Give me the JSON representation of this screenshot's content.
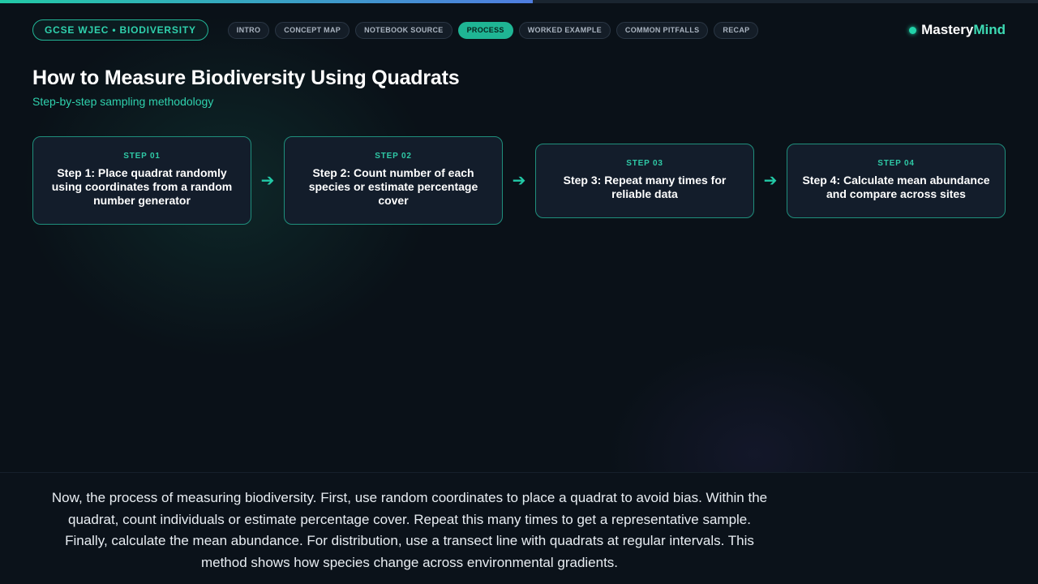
{
  "progress": {
    "fraction": 0.513
  },
  "header": {
    "course_badge": "GCSE WJEC • BIODIVERSITY",
    "tabs": [
      {
        "label": "INTRO",
        "active": false
      },
      {
        "label": "CONCEPT MAP",
        "active": false
      },
      {
        "label": "NOTEBOOK SOURCE",
        "active": false
      },
      {
        "label": "PROCESS",
        "active": true
      },
      {
        "label": "WORKED EXAMPLE",
        "active": false
      },
      {
        "label": "COMMON PITFALLS",
        "active": false
      },
      {
        "label": "RECAP",
        "active": false
      }
    ],
    "brand": {
      "part1": "Mastery",
      "part2": "Mind"
    }
  },
  "main": {
    "title": "How to Measure Biodiversity Using Quadrats",
    "subtitle": "Step-by-step sampling methodology",
    "steps": [
      {
        "number": "STEP 01",
        "text": "Step 1: Place quadrat randomly using coordinates from a random number generator"
      },
      {
        "number": "STEP 02",
        "text": "Step 2: Count number of each species or estimate percentage cover"
      },
      {
        "number": "STEP 03",
        "text": "Step 3: Repeat many times for reliable data"
      },
      {
        "number": "STEP 04",
        "text": "Step 4: Calculate mean abundance and compare across sites"
      }
    ],
    "arrow_glyph": "➔"
  },
  "caption": {
    "text": "Now, the process of measuring biodiversity. First, use random coordinates to place a quadrat to avoid bias. Within the quadrat, count individuals or estimate percentage cover. Repeat this many times to get a representative sample. Finally, calculate the mean abundance. For distribution, use a transect line with quadrats at regular intervals. This method shows how species change across environmental gradients."
  },
  "colors": {
    "accent": "#22c9a6",
    "background": "#0a1118",
    "card": "#131d2b"
  }
}
